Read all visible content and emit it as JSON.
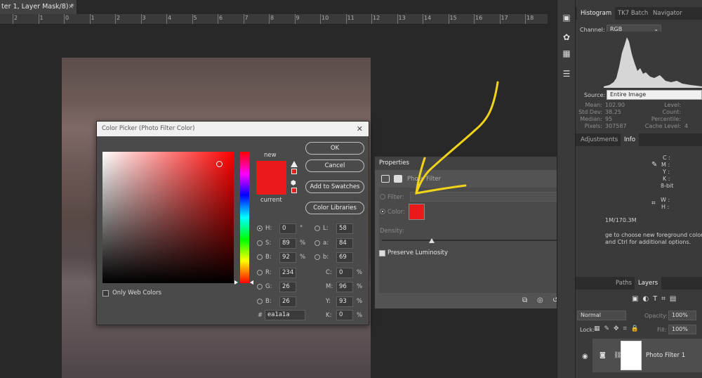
{
  "document_tab": {
    "title": "ter 1, Layer Mask/8) *",
    "close": "×"
  },
  "ruler": {
    "ticks": [
      "2",
      "1",
      "0",
      "1",
      "2",
      "3",
      "4",
      "5",
      "6",
      "7",
      "8",
      "9",
      "10",
      "11",
      "12",
      "13",
      "14",
      "15",
      "16",
      "17",
      "18"
    ]
  },
  "color_picker": {
    "title": "Color Picker (Photo Filter Color)",
    "close": "✕",
    "new_label": "new",
    "current_label": "current",
    "new_color": "#ea1a1a",
    "buttons": {
      "ok": "OK",
      "cancel": "Cancel",
      "add_to_swatches": "Add to Swatches",
      "color_libraries": "Color Libraries"
    },
    "only_web_colors": "Only Web Colors",
    "hsb": {
      "h_label": "H:",
      "h": "0",
      "h_unit": "°",
      "s_label": "S:",
      "s": "89",
      "s_unit": "%",
      "b_label": "B:",
      "b": "92",
      "b_unit": "%"
    },
    "rgb": {
      "r_label": "R:",
      "r": "234",
      "g_label": "G:",
      "g": "26",
      "b_label": "B:",
      "b": "26"
    },
    "lab": {
      "l_label": "L:",
      "l": "58",
      "a_label": "a:",
      "a": "84",
      "b_label": "b:",
      "b": "69"
    },
    "cmyk": {
      "c_label": "C:",
      "c": "0",
      "m_label": "M:",
      "m": "96",
      "y_label": "Y:",
      "y": "93",
      "k_label": "K:",
      "k": "0",
      "unit": "%"
    },
    "hex_label": "#",
    "hex": "ea1a1a"
  },
  "properties": {
    "title": "Properties",
    "layer_type": "Photo Filter",
    "filter_label": "Filter:",
    "color_label": "Color:",
    "density_label": "Density:",
    "density_value": "25",
    "density_unit": "%",
    "preserve_luminosity": "Preserve Luminosity",
    "filter_color": "#ea1a1a"
  },
  "right_panel": {
    "top_tabs": [
      "Histogram",
      "TK7 Batch",
      "Navigator"
    ],
    "channel_label": "Channel:",
    "channel_value": "RGB",
    "source_label": "Source:",
    "source_value": "Entire Image",
    "stats_left": [
      [
        "Mean:",
        "102.90"
      ],
      [
        "Std Dev:",
        "38.25"
      ],
      [
        "Median:",
        "95"
      ],
      [
        "Pixels:",
        "307587"
      ]
    ],
    "stats_right": [
      [
        "Level:",
        ""
      ],
      [
        "Count:",
        ""
      ],
      [
        "Percentile:",
        ""
      ],
      [
        "Cache Level:",
        "4"
      ]
    ],
    "mid_tabs": [
      "Adjustments",
      "Info"
    ],
    "info_cmyk": [
      "C :",
      "M :",
      "Y :",
      "K :"
    ],
    "info_bits": "8-bit",
    "info_wh": [
      "W :",
      "H :"
    ],
    "doc_size": "1M/170.3M",
    "hint_line1": "ge to choose new foreground color.",
    "hint_line2": "and Ctrl for additional options.",
    "layers_tabs": [
      "Paths",
      "Layers"
    ],
    "blend_mode": "Normal",
    "opacity_label": "Opacity:",
    "opacity_value": "100%",
    "lock_label": "Lock:",
    "fill_label": "Fill:",
    "fill_value": "100%",
    "layer_name": "Photo Filter 1"
  },
  "colors": {
    "accent_yellow": "#f2d31b",
    "dialog_bg": "#4a4a4a",
    "panel_bg": "#3a3a3a"
  }
}
